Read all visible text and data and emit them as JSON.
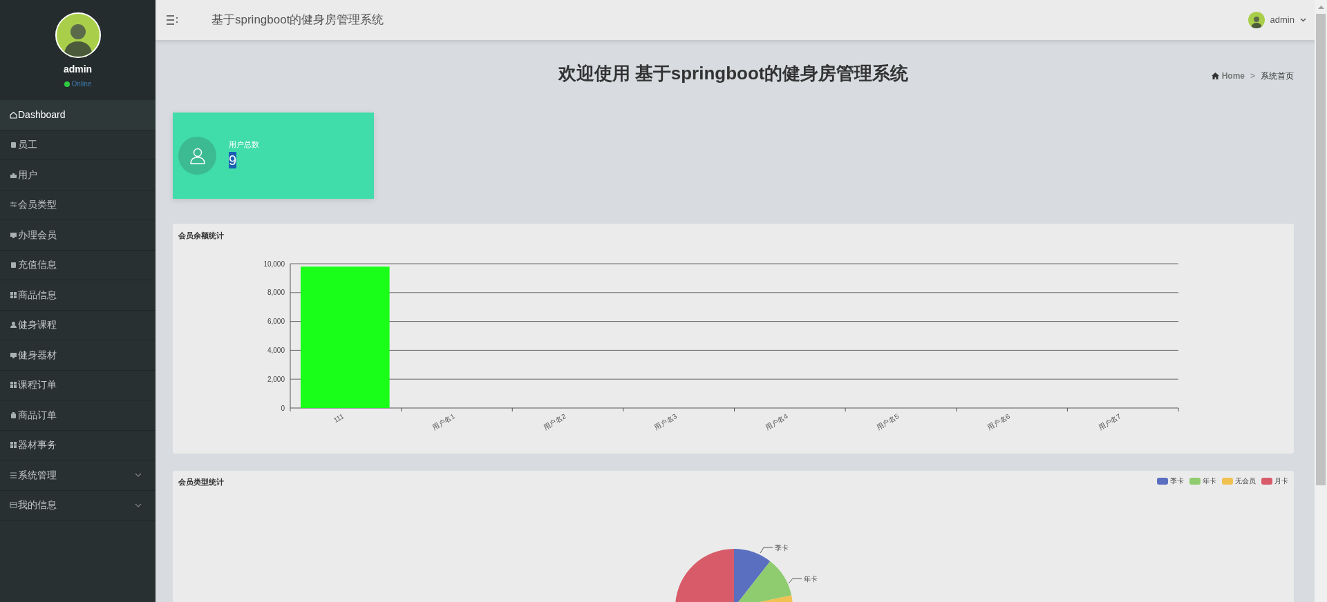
{
  "sidebar": {
    "user": {
      "name": "admin",
      "status": "Online"
    },
    "items": [
      {
        "label": "Dashboard",
        "selected": true,
        "kind": "link"
      },
      {
        "label": "员工",
        "selected": false,
        "kind": "link"
      },
      {
        "label": "用户",
        "selected": false,
        "kind": "link"
      },
      {
        "label": "会员类型",
        "selected": false,
        "kind": "link"
      },
      {
        "label": "办理会员",
        "selected": false,
        "kind": "link"
      },
      {
        "label": "充值信息",
        "selected": false,
        "kind": "link"
      },
      {
        "label": "商品信息",
        "selected": false,
        "kind": "link"
      },
      {
        "label": "健身课程",
        "selected": false,
        "kind": "link"
      },
      {
        "label": "健身器材",
        "selected": false,
        "kind": "link"
      },
      {
        "label": "课程订单",
        "selected": false,
        "kind": "link"
      },
      {
        "label": "商品订单",
        "selected": false,
        "kind": "link"
      },
      {
        "label": "器材事务",
        "selected": false,
        "kind": "link"
      },
      {
        "label": "系统管理",
        "selected": false,
        "kind": "group",
        "expanded": false
      },
      {
        "label": "我的信息",
        "selected": false,
        "kind": "group",
        "expanded": false
      }
    ]
  },
  "topbar": {
    "title": "基于springboot的健身房管理系统",
    "user": "admin"
  },
  "page": {
    "heading": "欢迎使用 基于springboot的健身房管理系统",
    "breadcrumb": [
      "Home",
      "系统首页"
    ],
    "separator": ">"
  },
  "stat_card": {
    "label": "用户总数",
    "value": "9"
  },
  "balance_panel": {
    "title": "会员余额统计",
    "chart_data": {
      "type": "bar",
      "categories": [
        "111",
        "用户名1",
        "用户名2",
        "用户名3",
        "用户名4",
        "用户名5",
        "用户名6",
        "用户名7"
      ],
      "series": [
        {
          "color": "#1aff1a",
          "values": [
            9800,
            0,
            0,
            0,
            0,
            0,
            0,
            0
          ]
        }
      ],
      "grid": true,
      "ylim": [
        0,
        10000
      ],
      "yticks": [
        {
          "value": 0,
          "label": "0"
        },
        {
          "value": 2000,
          "label": "2,000"
        },
        {
          "value": 4000,
          "label": "4,000"
        },
        {
          "value": 6000,
          "label": "6,000"
        },
        {
          "value": 8000,
          "label": "8,000"
        },
        {
          "value": 10000,
          "label": "10,000"
        }
      ]
    }
  },
  "type_panel": {
    "title": "会员类型统计",
    "legend": [
      {
        "label": "季卡",
        "color": "#5b6fc0"
      },
      {
        "label": "年卡",
        "color": "#8fcb6f"
      },
      {
        "label": "无会员",
        "color": "#f1c152"
      },
      {
        "label": "月卡",
        "color": "#d75b68"
      }
    ],
    "slice_labels": [
      "季卡",
      "年卡"
    ]
  }
}
